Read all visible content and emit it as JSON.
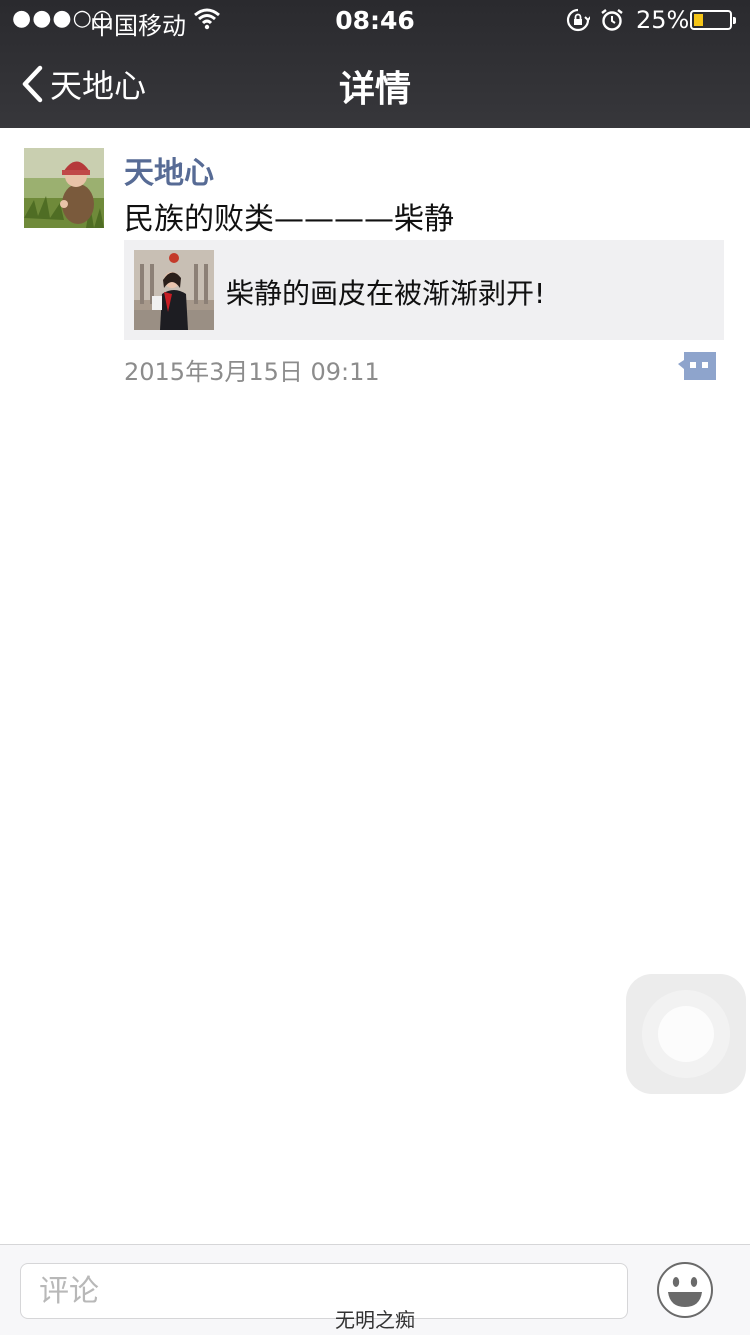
{
  "status_bar": {
    "signal": "●●●○○",
    "carrier": "中国移动",
    "time": "08:46",
    "battery_percent": "25%",
    "battery_level": 0.25
  },
  "nav": {
    "back_label": "天地心",
    "title": "详情"
  },
  "post": {
    "author": "天地心",
    "text": "民族的败类————柴静",
    "link_title": "柴静的画皮在被渐渐剥开!",
    "timestamp": "2015年3月15日 09:11"
  },
  "bottom_bar": {
    "comment_placeholder": "评论"
  },
  "watermark": "无明之痴",
  "colors": {
    "header_bg": "#2a2a2e",
    "author_name": "#576b95",
    "comment_icon": "#8ea4cc",
    "battery_fill": "#f5c518"
  }
}
